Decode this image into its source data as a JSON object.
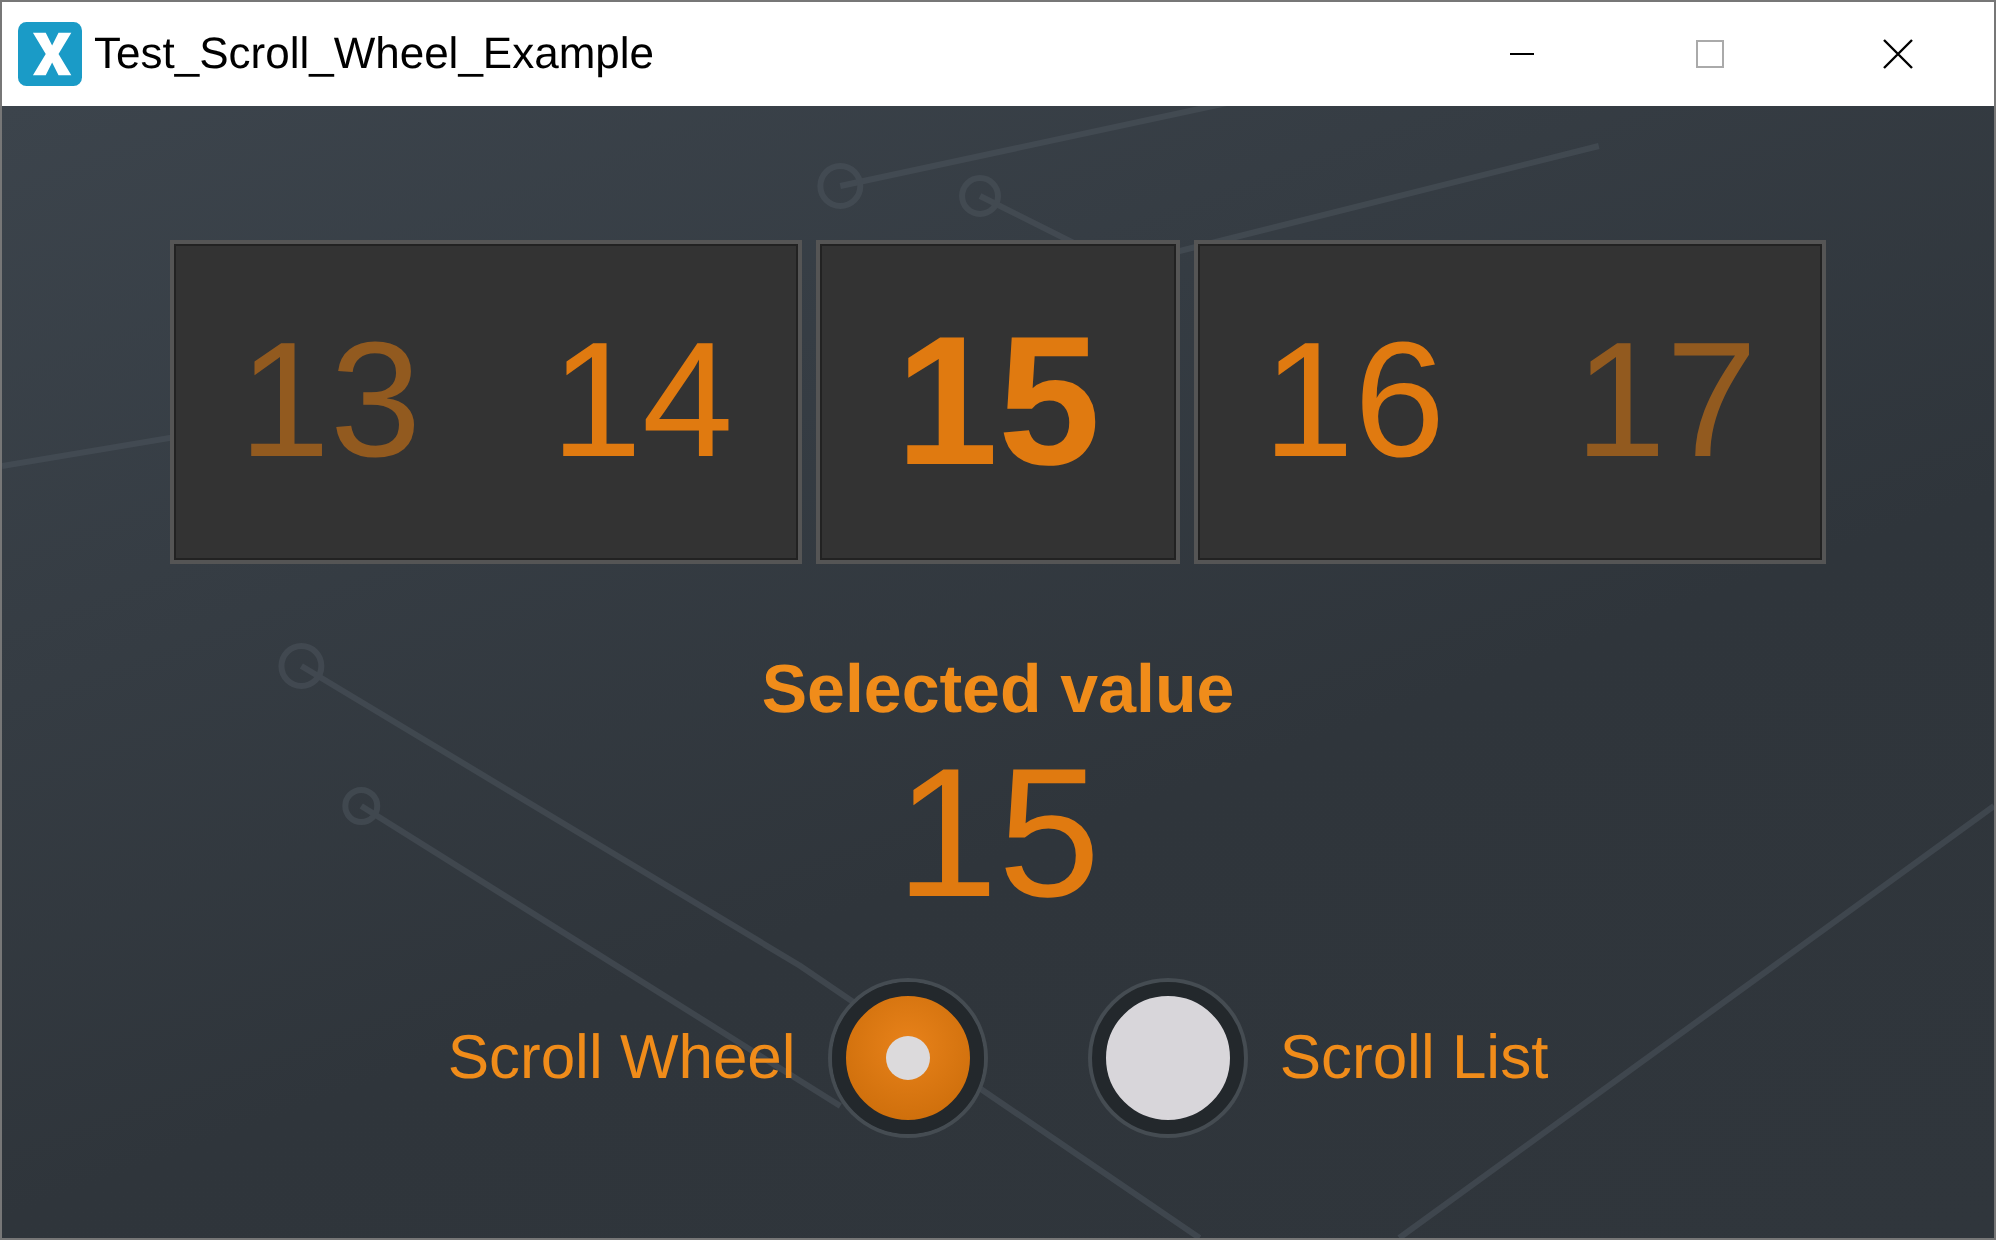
{
  "window": {
    "title": "Test_Scroll_Wheel_Example"
  },
  "scroll_wheel": {
    "items": [
      {
        "label": "13",
        "selected": false
      },
      {
        "label": "14",
        "selected": false
      },
      {
        "label": "15",
        "selected": true
      },
      {
        "label": "16",
        "selected": false
      },
      {
        "label": "17",
        "selected": false
      }
    ]
  },
  "selected_value": {
    "label": "Selected value",
    "value": "15"
  },
  "modes": [
    {
      "label": "Scroll Wheel",
      "selected": true
    },
    {
      "label": "Scroll List",
      "selected": false
    }
  ]
}
